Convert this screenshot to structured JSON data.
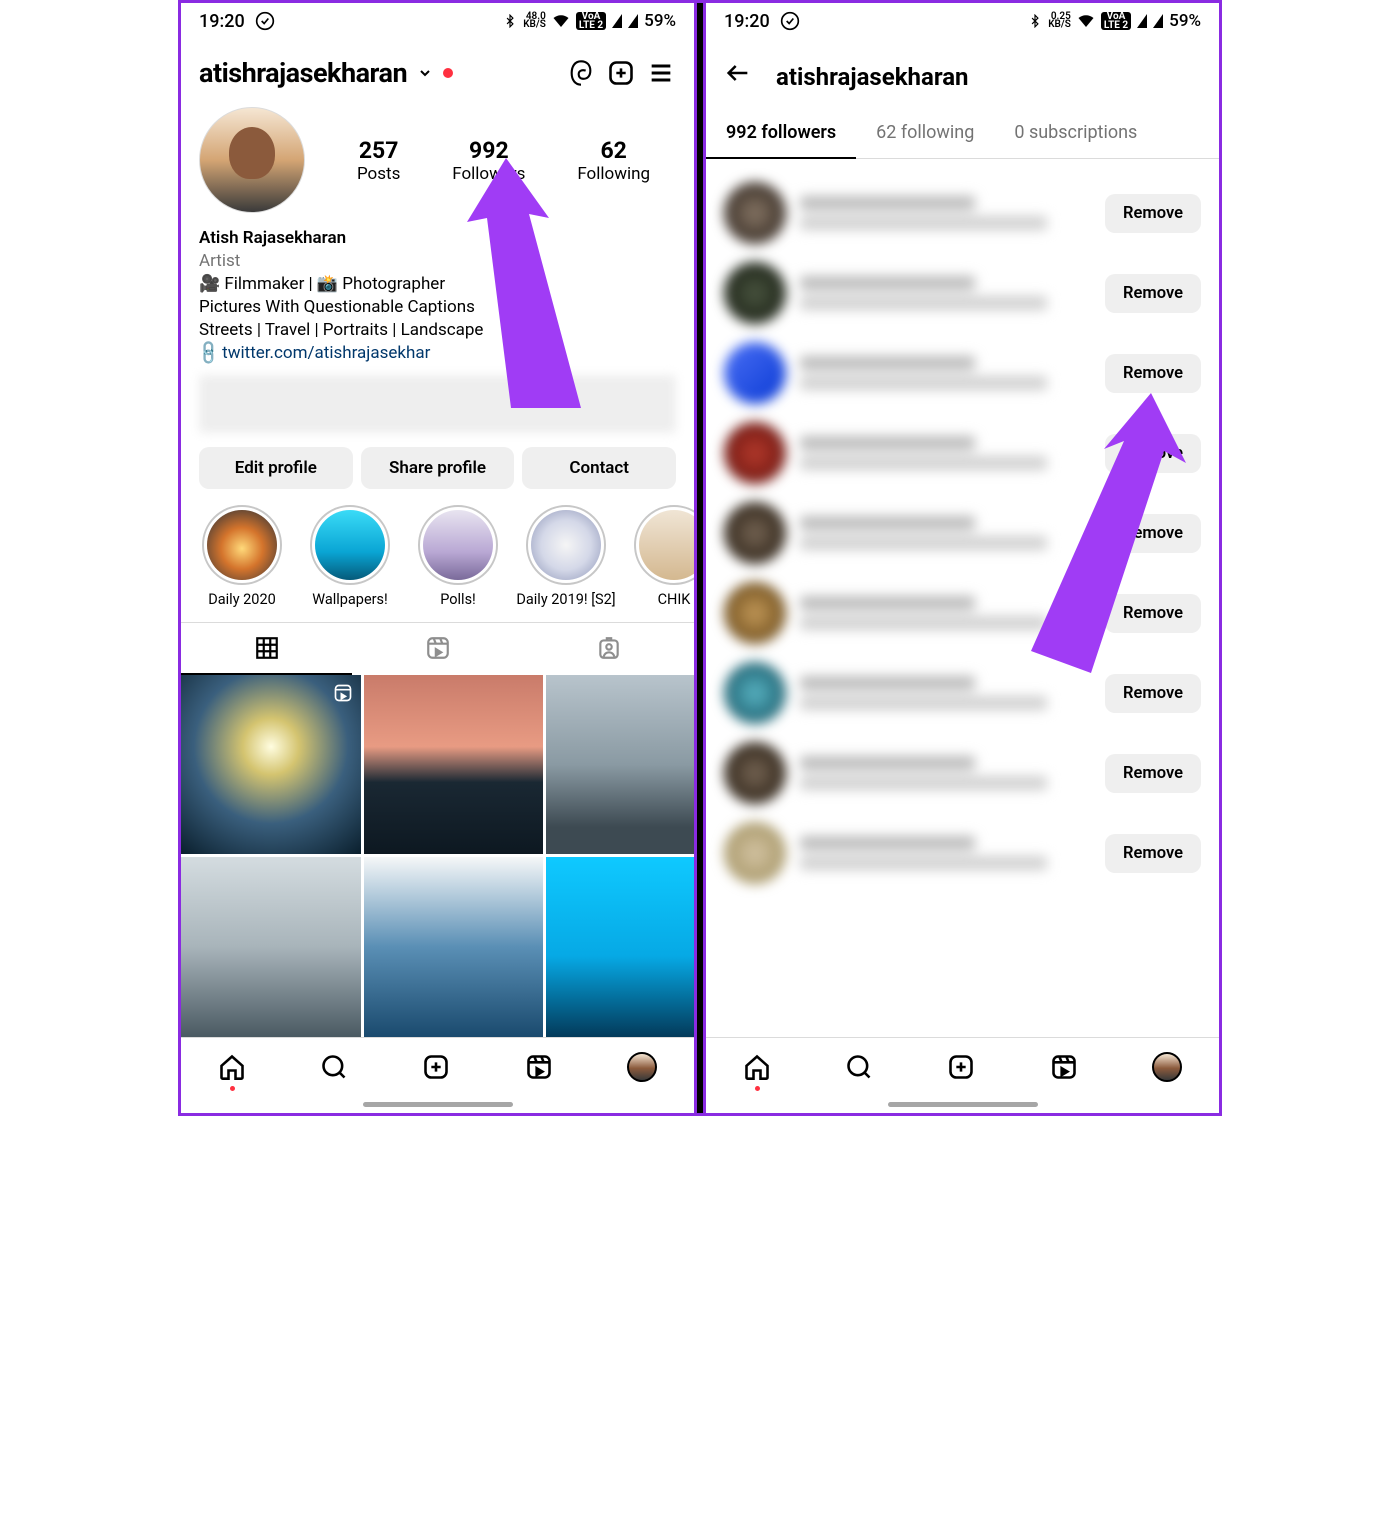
{
  "status": {
    "time": "19:20",
    "net_speed_value": "48.0",
    "net_speed_value2": "0.25",
    "net_speed_unit": "KB/S",
    "lte_badge_a": "VoA",
    "lte_badge_b": "LTE 2",
    "battery": "59%"
  },
  "profile": {
    "username": "atishrajasekharan",
    "stats": {
      "posts": {
        "count": "257",
        "label": "Posts"
      },
      "followers": {
        "count": "992",
        "label": "Followers"
      },
      "following": {
        "count": "62",
        "label": "Following"
      }
    },
    "display_name": "Atish Rajasekharan",
    "category": "Artist",
    "bio_lines": [
      "🎥 Filmmaker | 📸 Photographer",
      "Pictures With Questionable Captions",
      "Streets | Travel | Portraits | Landscape"
    ],
    "link": "twitter.com/atishrajasekhar",
    "buttons": {
      "edit": "Edit profile",
      "share": "Share profile",
      "contact": "Contact"
    },
    "highlights": [
      {
        "label": "Daily 2020"
      },
      {
        "label": "Wallpapers!"
      },
      {
        "label": "Polls!"
      },
      {
        "label": "Daily 2019! [S2]"
      },
      {
        "label": "CHIK"
      }
    ]
  },
  "followers_screen": {
    "title": "atishrajasekharan",
    "tabs": {
      "followers": "992 followers",
      "following": "62 following",
      "subscriptions": "0 subscriptions"
    },
    "remove_label": "Remove",
    "rows": 9
  }
}
